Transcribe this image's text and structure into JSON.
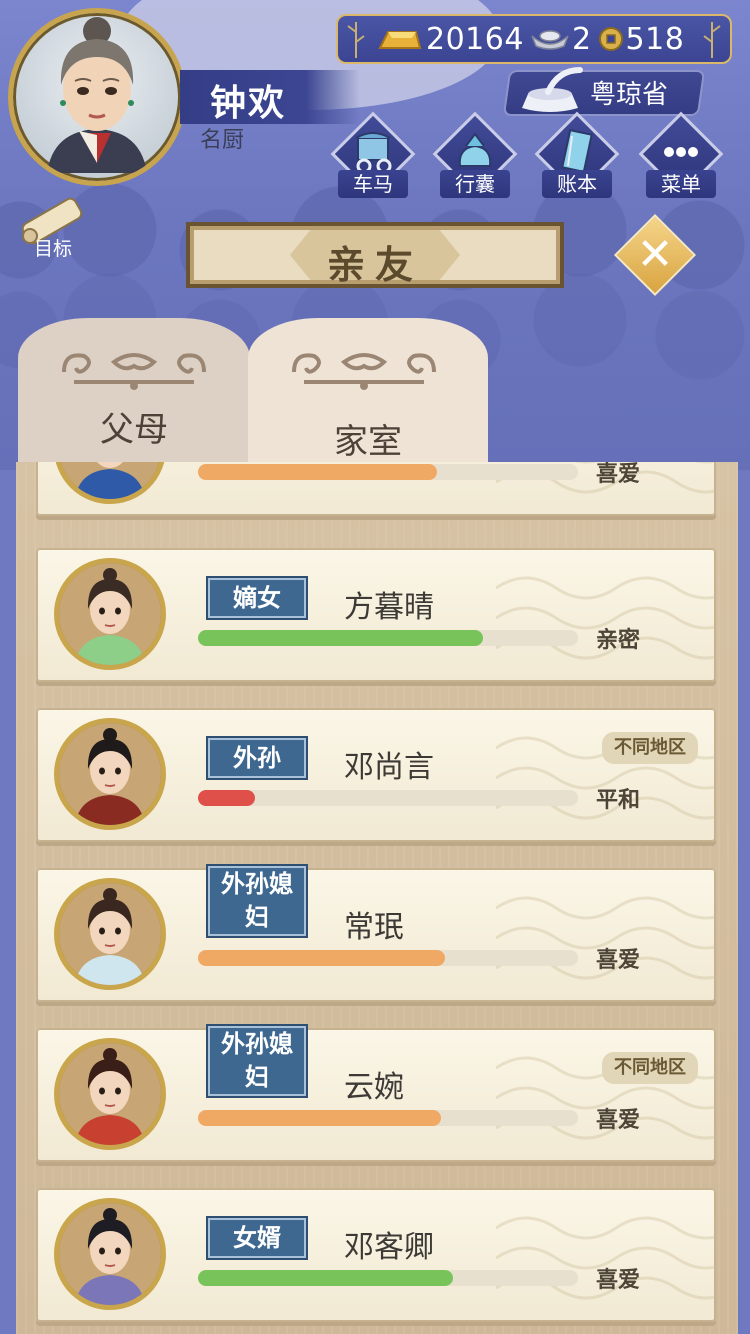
{
  "header": {
    "player_name": "钟欢",
    "player_title": "名厨",
    "goal_label": "目标",
    "region": "粤琼省"
  },
  "currency": {
    "gold": "20164",
    "silver": "2",
    "coins": "518"
  },
  "menu": [
    {
      "label": "车马",
      "icon": "carriage-icon"
    },
    {
      "label": "行囊",
      "icon": "bundle-icon"
    },
    {
      "label": "账本",
      "icon": "ledger-icon"
    },
    {
      "label": "菜单",
      "icon": "more-icon"
    }
  ],
  "title": "亲友",
  "tabs": [
    {
      "label": "父母",
      "active": false
    },
    {
      "label": "家室",
      "active": true
    }
  ],
  "colors": {
    "bar_orange": "#f0a865",
    "bar_green": "#79c45a",
    "bar_red": "#e0504a",
    "tag_blue": "#3f6891"
  },
  "relatives": [
    {
      "relation": "",
      "name": "",
      "attitude": "喜爱",
      "affinity": 0.63,
      "bar_color": "#f0a865",
      "region_note": ""
    },
    {
      "relation": "嫡女",
      "name": "方暮晴",
      "attitude": "亲密",
      "affinity": 0.75,
      "bar_color": "#79c45a",
      "region_note": ""
    },
    {
      "relation": "外孙",
      "name": "邓尚言",
      "attitude": "平和",
      "affinity": 0.15,
      "bar_color": "#e0504a",
      "region_note": "不同地区"
    },
    {
      "relation": "外孙媳妇",
      "name": "常珉",
      "attitude": "喜爱",
      "affinity": 0.65,
      "bar_color": "#f0a865",
      "region_note": ""
    },
    {
      "relation": "外孙媳妇",
      "name": "云婉",
      "attitude": "喜爱",
      "affinity": 0.64,
      "bar_color": "#f0a865",
      "region_note": "不同地区"
    },
    {
      "relation": "女婿",
      "name": "邓客卿",
      "attitude": "喜爱",
      "affinity": 0.67,
      "bar_color": "#79c45a",
      "region_note": ""
    }
  ]
}
